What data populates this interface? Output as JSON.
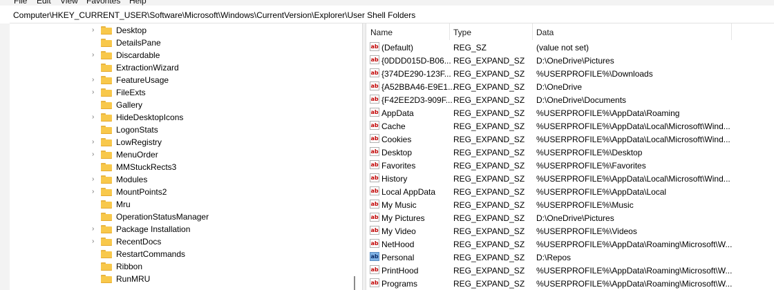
{
  "menu": [
    "File",
    "Edit",
    "View",
    "Favorites",
    "Help"
  ],
  "address": "Computer\\HKEY_CURRENT_USER\\Software\\Microsoft\\Windows\\CurrentVersion\\Explorer\\User Shell Folders",
  "tree": [
    {
      "label": "Desktop",
      "expandable": true
    },
    {
      "label": "DetailsPane",
      "expandable": false
    },
    {
      "label": "Discardable",
      "expandable": true
    },
    {
      "label": "ExtractionWizard",
      "expandable": false
    },
    {
      "label": "FeatureUsage",
      "expandable": true
    },
    {
      "label": "FileExts",
      "expandable": true
    },
    {
      "label": "Gallery",
      "expandable": false
    },
    {
      "label": "HideDesktopIcons",
      "expandable": true
    },
    {
      "label": "LogonStats",
      "expandable": false
    },
    {
      "label": "LowRegistry",
      "expandable": true
    },
    {
      "label": "MenuOrder",
      "expandable": true
    },
    {
      "label": "MMStuckRects3",
      "expandable": false
    },
    {
      "label": "Modules",
      "expandable": true
    },
    {
      "label": "MountPoints2",
      "expandable": true
    },
    {
      "label": "Mru",
      "expandable": false
    },
    {
      "label": "OperationStatusManager",
      "expandable": false
    },
    {
      "label": "Package Installation",
      "expandable": true
    },
    {
      "label": "RecentDocs",
      "expandable": true
    },
    {
      "label": "RestartCommands",
      "expandable": false
    },
    {
      "label": "Ribbon",
      "expandable": false
    },
    {
      "label": "RunMRU",
      "expandable": false
    }
  ],
  "columns": {
    "name": "Name",
    "type": "Type",
    "data": "Data"
  },
  "values": [
    {
      "name": "(Default)",
      "type": "REG_SZ",
      "data": "(value not set)",
      "icon": "ab"
    },
    {
      "name": "{0DDD015D-B06...",
      "type": "REG_EXPAND_SZ",
      "data": "D:\\OneDrive\\Pictures",
      "icon": "ab"
    },
    {
      "name": "{374DE290-123F...",
      "type": "REG_EXPAND_SZ",
      "data": "%USERPROFILE%\\Downloads",
      "icon": "ab"
    },
    {
      "name": "{A52BBA46-E9E1...",
      "type": "REG_EXPAND_SZ",
      "data": "D:\\OneDrive",
      "icon": "ab"
    },
    {
      "name": "{F42EE2D3-909F...",
      "type": "REG_EXPAND_SZ",
      "data": "D:\\OneDrive\\Documents",
      "icon": "ab"
    },
    {
      "name": "AppData",
      "type": "REG_EXPAND_SZ",
      "data": "%USERPROFILE%\\AppData\\Roaming",
      "icon": "ab"
    },
    {
      "name": "Cache",
      "type": "REG_EXPAND_SZ",
      "data": "%USERPROFILE%\\AppData\\Local\\Microsoft\\Wind...",
      "icon": "ab"
    },
    {
      "name": "Cookies",
      "type": "REG_EXPAND_SZ",
      "data": "%USERPROFILE%\\AppData\\Local\\Microsoft\\Wind...",
      "icon": "ab"
    },
    {
      "name": "Desktop",
      "type": "REG_EXPAND_SZ",
      "data": "%USERPROFILE%\\Desktop",
      "icon": "ab"
    },
    {
      "name": "Favorites",
      "type": "REG_EXPAND_SZ",
      "data": "%USERPROFILE%\\Favorites",
      "icon": "ab"
    },
    {
      "name": "History",
      "type": "REG_EXPAND_SZ",
      "data": "%USERPROFILE%\\AppData\\Local\\Microsoft\\Wind...",
      "icon": "ab"
    },
    {
      "name": "Local AppData",
      "type": "REG_EXPAND_SZ",
      "data": "%USERPROFILE%\\AppData\\Local",
      "icon": "ab"
    },
    {
      "name": "My Music",
      "type": "REG_EXPAND_SZ",
      "data": "%USERPROFILE%\\Music",
      "icon": "ab"
    },
    {
      "name": "My Pictures",
      "type": "REG_EXPAND_SZ",
      "data": "D:\\OneDrive\\Pictures",
      "icon": "ab"
    },
    {
      "name": "My Video",
      "type": "REG_EXPAND_SZ",
      "data": "%USERPROFILE%\\Videos",
      "icon": "ab"
    },
    {
      "name": "NetHood",
      "type": "REG_EXPAND_SZ",
      "data": "%USERPROFILE%\\AppData\\Roaming\\Microsoft\\W...",
      "icon": "ab"
    },
    {
      "name": "Personal",
      "type": "REG_EXPAND_SZ",
      "data": "D:\\Repos",
      "icon": "ab-selected"
    },
    {
      "name": "PrintHood",
      "type": "REG_EXPAND_SZ",
      "data": "%USERPROFILE%\\AppData\\Roaming\\Microsoft\\W...",
      "icon": "ab"
    },
    {
      "name": "Programs",
      "type": "REG_EXPAND_SZ",
      "data": "%USERPROFILE%\\AppData\\Roaming\\Microsoft\\W...",
      "icon": "ab"
    }
  ],
  "icon_glyph": "ab",
  "colors": {
    "folder": "#f8c84b",
    "string_icon_text": "#c00000",
    "selected_icon": "#7fb2e5"
  }
}
